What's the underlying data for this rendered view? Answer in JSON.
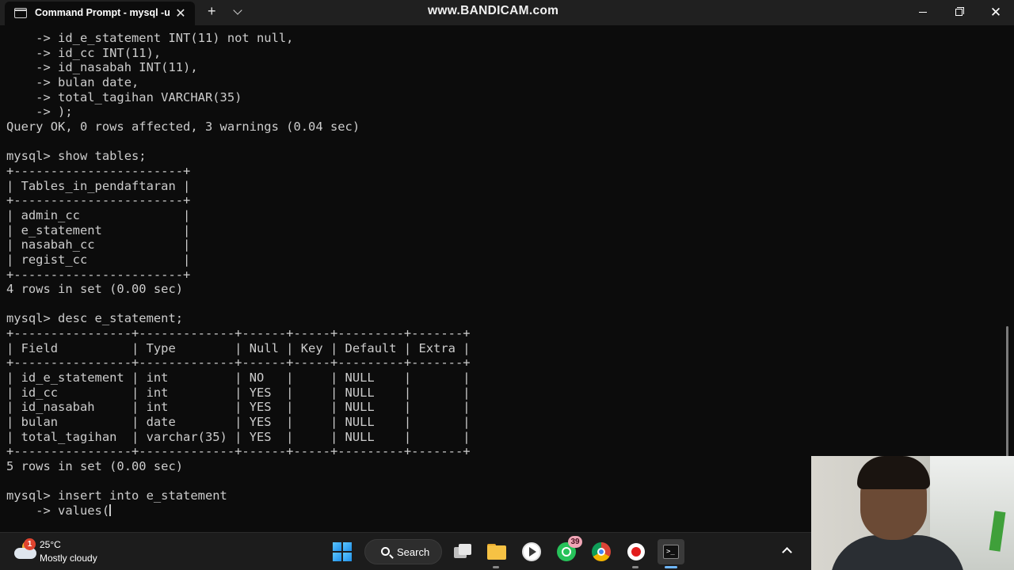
{
  "titlebar": {
    "tab_title": "Command Prompt - mysql -u",
    "tab_close": "✕",
    "new_tab": "+",
    "watermark": "www.BANDICAM.com",
    "close": "✕"
  },
  "terminal": {
    "lines": [
      "    -> id_e_statement INT(11) not null,",
      "    -> id_cc INT(11),",
      "    -> id_nasabah INT(11),",
      "    -> bulan date,",
      "    -> total_tagihan VARCHAR(35)",
      "    -> );",
      "Query OK, 0 rows affected, 3 warnings (0.04 sec)",
      "",
      "mysql> show tables;",
      "+-----------------------+",
      "| Tables_in_pendaftaran |",
      "+-----------------------+",
      "| admin_cc              |",
      "| e_statement           |",
      "| nasabah_cc            |",
      "| regist_cc             |",
      "+-----------------------+",
      "4 rows in set (0.00 sec)",
      "",
      "mysql> desc e_statement;",
      "+----------------+-------------+------+-----+---------+-------+",
      "| Field          | Type        | Null | Key | Default | Extra |",
      "+----------------+-------------+------+-----+---------+-------+",
      "| id_e_statement | int         | NO   |     | NULL    |       |",
      "| id_cc          | int         | YES  |     | NULL    |       |",
      "| id_nasabah     | int         | YES  |     | NULL    |       |",
      "| bulan          | date        | YES  |     | NULL    |       |",
      "| total_tagihan  | varchar(35) | YES  |     | NULL    |       |",
      "+----------------+-------------+------+-----+---------+-------+",
      "5 rows in set (0.00 sec)",
      "",
      "mysql> insert into e_statement",
      "    -> values("
    ]
  },
  "taskbar": {
    "weather_badge": "1",
    "weather_temp": "25°C",
    "weather_desc": "Mostly cloudy",
    "search_label": "Search",
    "whatsapp_badge": "39",
    "terminal_glyph": ">_"
  },
  "icons": {
    "tab": "terminal-icon",
    "weather": "partly-cloudy-icon",
    "start": "windows-logo-icon",
    "search": "search-icon",
    "taskview": "task-view-icon",
    "files": "folder-icon",
    "media": "media-player-icon",
    "whatsapp": "whatsapp-icon",
    "chrome": "chrome-icon",
    "recorder": "bandicam-record-icon",
    "terminal": "terminal-icon",
    "tray": "chevron-up-icon"
  },
  "colors": {
    "terminal_bg": "#0c0c0c",
    "terminal_fg": "#cccccc",
    "taskbar_bg": "#1c1c1c",
    "accent": "#6fb8ff"
  }
}
